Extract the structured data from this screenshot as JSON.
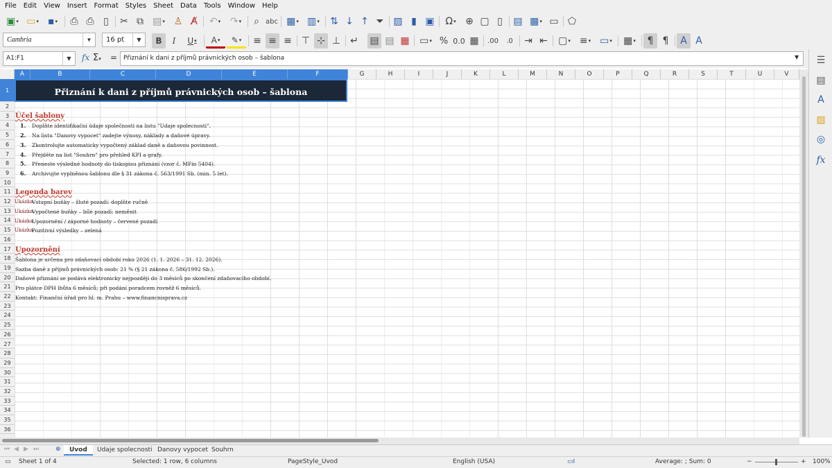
{
  "menu": [
    "File",
    "Edit",
    "View",
    "Insert",
    "Format",
    "Styles",
    "Sheet",
    "Data",
    "Tools",
    "Window",
    "Help"
  ],
  "toolbar": {
    "font_name": "Cambria",
    "font_size": "16 pt"
  },
  "formula_bar": {
    "name_box": "A1:F1",
    "content": "Přiznání k dani z příjmů právnických osob – šablona"
  },
  "columns": [
    "A",
    "B",
    "C",
    "D",
    "E",
    "F",
    "G",
    "H",
    "I",
    "J",
    "K",
    "L",
    "M",
    "N",
    "O",
    "P",
    "Q",
    "R",
    "S",
    "T",
    "U",
    "V"
  ],
  "rows": [
    "1",
    "2",
    "3",
    "4",
    "5",
    "6",
    "7",
    "8",
    "9",
    "10",
    "11",
    "12",
    "13",
    "14",
    "15",
    "16",
    "17",
    "18",
    "19",
    "20",
    "21",
    "22",
    "23",
    "24",
    "25",
    "26",
    "27",
    "28",
    "29",
    "30",
    "31",
    "32",
    "33",
    "34",
    "35",
    "36"
  ],
  "sheet": {
    "title": "Přiznání k dani z příjmů právnických osob – šablona",
    "section_purpose": "Účel šablony",
    "steps": [
      {
        "n": "1.",
        "text": "Doplňte identifikační údaje společnosti na listu \"Udaje spolecnosti\"."
      },
      {
        "n": "2.",
        "text": "Na listu \"Danovy vypocet\" zadejte výnosy, náklady a daňové úpravy."
      },
      {
        "n": "3.",
        "text": "Zkontrolujte automaticky vypočtený základ daně a daňovou povinnost."
      },
      {
        "n": "4.",
        "text": "Přejděte na list \"Souhrn\" pro přehled KPI a grafy."
      },
      {
        "n": "5.",
        "text": "Přeneste výsledné hodnoty do tiskopisu přiznání (vzor č. MFin 5404)."
      },
      {
        "n": "6.",
        "text": "Archivujte vyplněnou šablonu dle § 31 zákona č. 563/1991 Sb. (min. 5 let)."
      }
    ],
    "section_legend": "Legenda barev",
    "legend_swatch": "Ukázka",
    "legend": [
      "Vstupní buňky – žluté pozadí: doplňte ručně",
      "Vypočtené buňky – bílé pozadí: neměnit",
      "Upozornění / záporné hodnoty – červené pozadí",
      "Pozitivní výsledky – zelená"
    ],
    "section_notice": "Upozornění",
    "notices": [
      "Šablona je určena pro zdaňovací období roku 2026 (1. 1. 2026 – 31. 12. 2026).",
      "Sazba daně z příjmů právnických osob: 21 % (§ 21 zákona č. 586/1992 Sb.).",
      "Daňové přiznání se podává elektronicky nejpozději do 3 měsíců po skončení zdaňovacího období.",
      "Pro plátce DPH lhůta 6 měsíců; při podání poradcem rovněž 6 měsíců.",
      "Kontakt: Finanční úřad pro hl. m. Prahu – www.financnisprava.cz"
    ]
  },
  "tabs": [
    "Uvod",
    "Udaje spolecnosti",
    "Danovy vypocet",
    "Souhrn"
  ],
  "active_tab": "Uvod",
  "status": {
    "sheet": "Sheet 1 of 4",
    "selection": "Selected: 1 row, 6 columns",
    "page_style": "PageStyle_Uvod",
    "language": "English (USA)",
    "summary": "Average: ; Sum: 0",
    "zoom": "100%"
  },
  "colors": {
    "title_bg": "#1c2738",
    "selection": "#3f84d8",
    "heading": "#c0392b"
  }
}
